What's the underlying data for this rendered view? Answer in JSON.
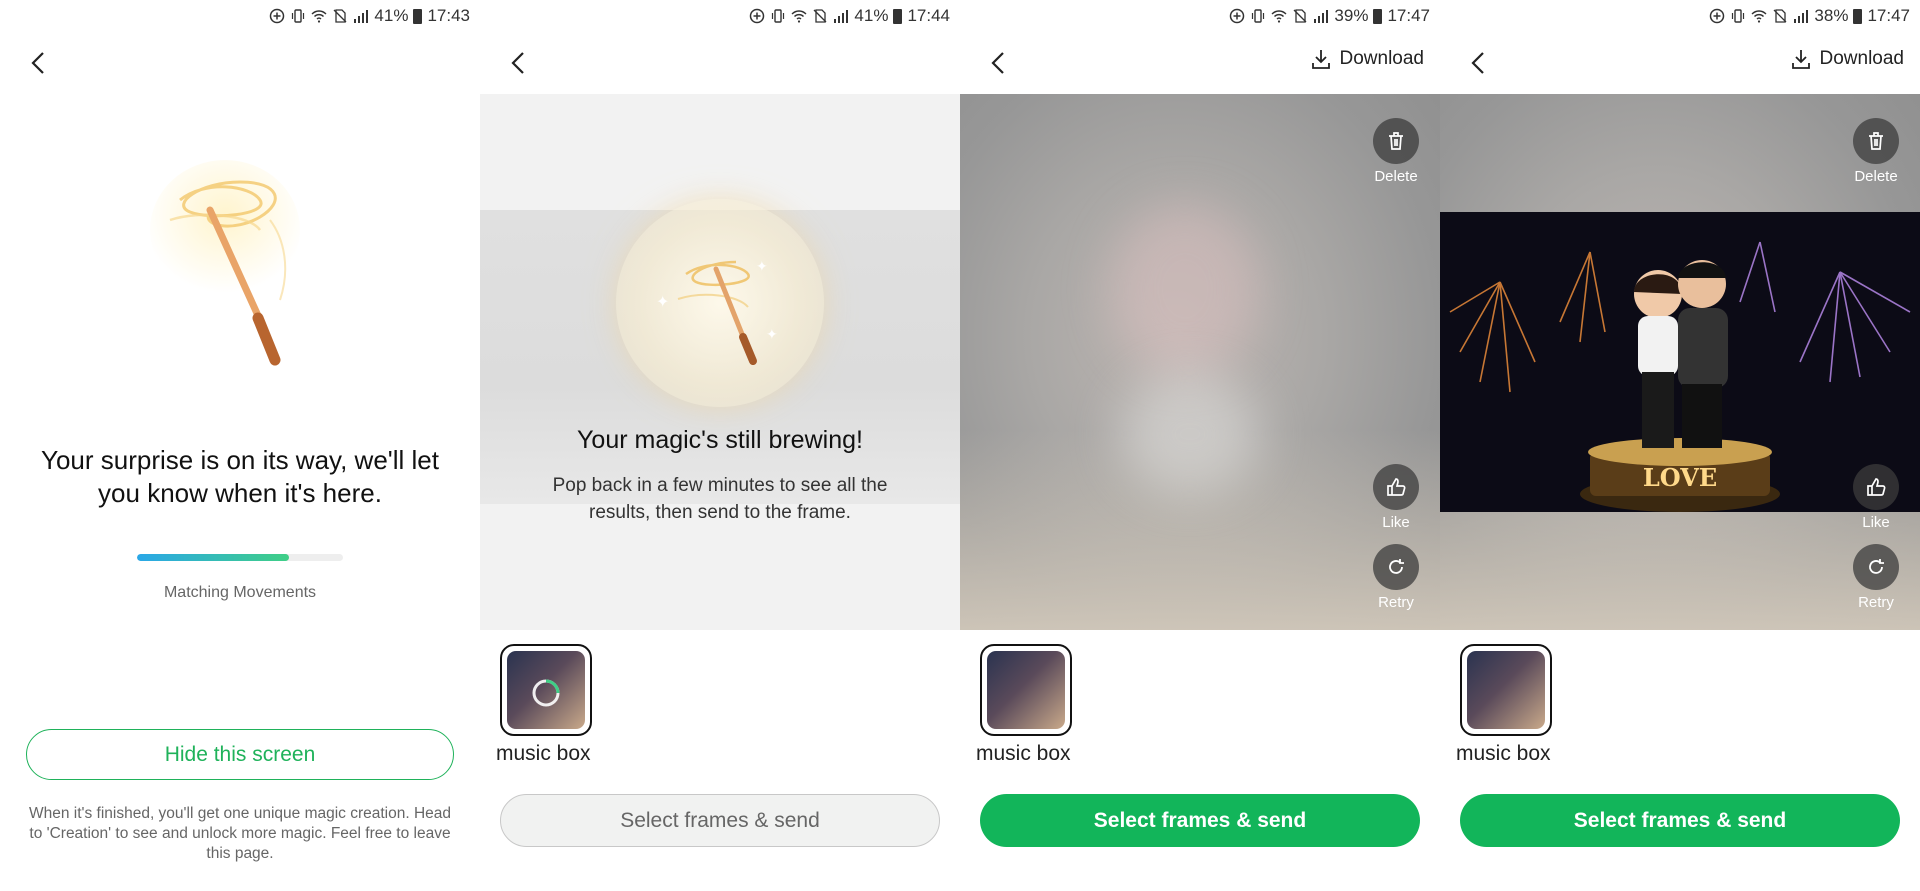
{
  "colors": {
    "accent_green": "#12b55a",
    "outline_green": "#1fb25a",
    "progress_start": "#2aa7e8",
    "progress_end": "#3fcf86"
  },
  "panels": [
    {
      "status": {
        "battery": "41%",
        "time": "17:43"
      },
      "message": "Your surprise is on its way, we'll let you know when it's here.",
      "progress": {
        "fraction": 0.74,
        "label": "Matching Movements"
      },
      "hide_button": "Hide this screen",
      "note": "When it's finished, you'll get one unique magic creation. Head to 'Creation' to see and unlock more magic. Feel free to leave this page."
    },
    {
      "status": {
        "battery": "41%",
        "time": "17:44"
      },
      "title": "Your magic's still brewing!",
      "text": "Pop back in a few minutes to see all the results, then send to the frame.",
      "thumb_label": "music box",
      "send_button": "Select frames & send"
    },
    {
      "status": {
        "battery": "39%",
        "time": "17:47"
      },
      "download": "Download",
      "actions": {
        "delete": "Delete",
        "like": "Like",
        "retry": "Retry"
      },
      "thumb_label": "music box",
      "send_button": "Select frames & send"
    },
    {
      "status": {
        "battery": "38%",
        "time": "17:47"
      },
      "download": "Download",
      "actions": {
        "delete": "Delete",
        "like": "Like",
        "retry": "Retry"
      },
      "photo_text": "LOVE",
      "thumb_label": "music box",
      "send_button": "Select frames & send"
    }
  ]
}
